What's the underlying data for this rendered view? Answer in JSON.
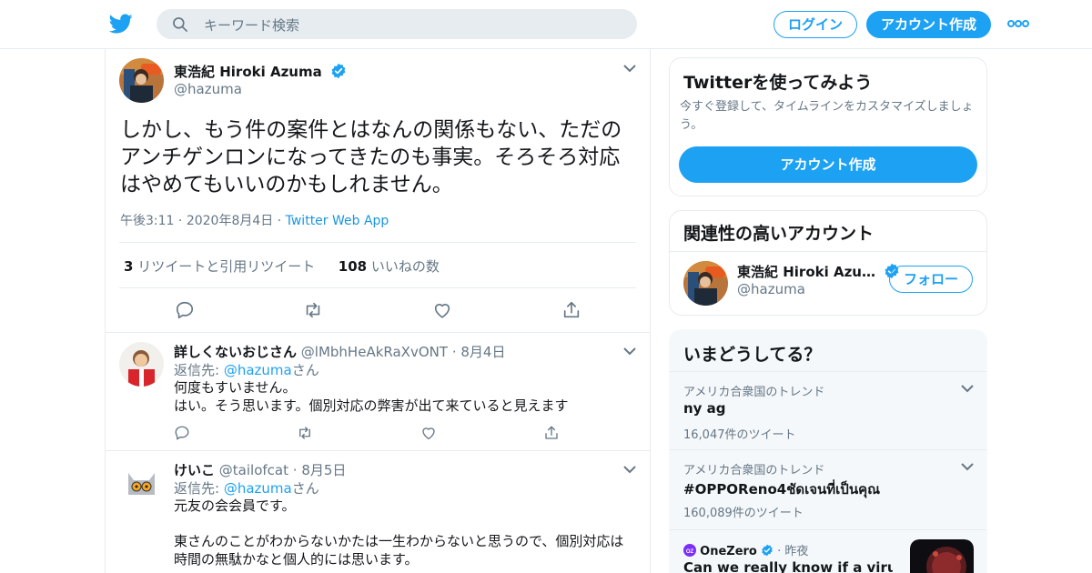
{
  "colors": {
    "accent": "#1da1f2",
    "link": "#1b95e0",
    "muted": "#657786",
    "text": "#14171a",
    "border": "#e6ecf0"
  },
  "header": {
    "logo_icon": "twitter-bird-icon",
    "search_placeholder": "キーワード検索",
    "login_label": "ログイン",
    "signup_label": "アカウント作成",
    "more_icon": "more-dots-icon"
  },
  "tweet": {
    "author_name": "東浩紀 Hiroki Azuma",
    "author_handle": "@hazuma",
    "body": "しかし、もう件の案件とはなんの関係もない、ただのアンチゲンロンになってきたのも事実。そろそろ対応はやめてもいいのかもしれません。",
    "time": "午後3:11",
    "date": "2020年8月4日",
    "client": "Twitter Web App",
    "retweet_count": "3",
    "retweet_label": "リツイートと引用リツイート",
    "like_count": "108",
    "like_label": "いいねの数"
  },
  "replies": [
    {
      "name": "詳しくないおじさん",
      "handle": "@lMbhHeAkRaXvONT",
      "date": "8月4日",
      "replying_prefix": "返信先: ",
      "replying_to": "@hazuma",
      "replying_suffix": "さん",
      "lines": [
        "何度もすいません。",
        "はい。そう思います。個別対応の弊害が出て来ていると見えます"
      ]
    },
    {
      "name": "けいこ",
      "handle": "@tailofcat",
      "date": "8月5日",
      "replying_prefix": "返信先: ",
      "replying_to": "@hazuma",
      "replying_suffix": "さん",
      "lines": [
        "元友の会会員です。",
        "東さんのことがわからないかたは一生わからないと思うので、個別対応は",
        "時間の無駄かなと個人的には思います。"
      ]
    }
  ],
  "sidebar": {
    "try_card": {
      "title": "Twitterを使ってみよう",
      "subtitle": "今すぐ登録して、タイムラインをカスタマイズしましょう。",
      "button": "アカウント作成"
    },
    "related_card": {
      "title": "関連性の高いアカウント",
      "name": "東浩紀 Hiroki Azu…",
      "handle": "@hazuma",
      "follow_label": "フォロー"
    },
    "trends_card": {
      "title": "いまどうしてる？",
      "items": [
        {
          "location": "アメリカ合衆国のトレンド",
          "name": "ny ag",
          "count": "16,047件のツイート"
        },
        {
          "location": "アメリカ合衆国のトレンド",
          "name": "#OPPOReno4ชัดเจนที่เป็นคุณ",
          "count": "160,089件のツイート"
        }
      ],
      "news": {
        "source": "OneZero",
        "time": "昨夜",
        "headline": "Can we really know if a virus was"
      }
    }
  }
}
